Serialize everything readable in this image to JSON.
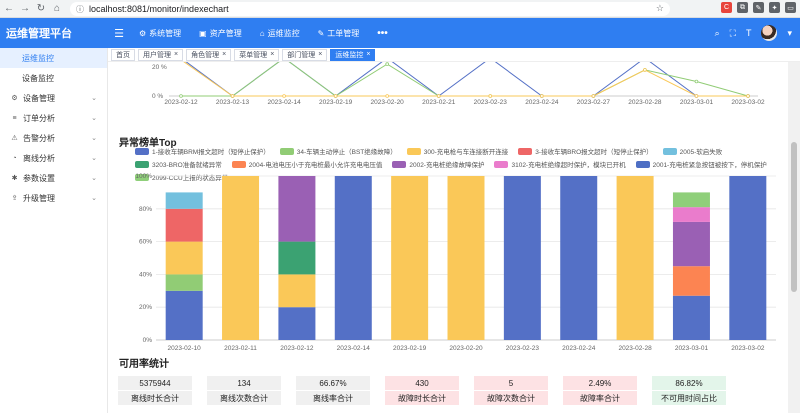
{
  "browser": {
    "url": "localhost:8081/monitor/indexechart",
    "ext_icons": [
      {
        "name": "c-extension-icon",
        "color": "#e8453c",
        "label": "C"
      },
      {
        "name": "copy-icon",
        "color": "#5f6368",
        "label": "⧉"
      },
      {
        "name": "edit-icon",
        "color": "#5f6368",
        "label": "✎"
      },
      {
        "name": "puzzle-icon",
        "color": "#5f6368",
        "label": "✦"
      },
      {
        "name": "window-icon",
        "color": "#5f6368",
        "label": "▭"
      }
    ]
  },
  "header": {
    "brand": "运维管理平台",
    "nav": [
      {
        "label": "系统管理",
        "icon": "⚙"
      },
      {
        "label": "资产管理",
        "icon": "▣"
      },
      {
        "label": "运维监控",
        "icon": "⌂"
      },
      {
        "label": "工单管理",
        "icon": "✎"
      }
    ],
    "more": "•••"
  },
  "sidebar": {
    "items": [
      {
        "label": "运维监控",
        "type": "sub",
        "active": true
      },
      {
        "label": "设备监控",
        "type": "sub",
        "active": false
      },
      {
        "label": "设备管理",
        "type": "group",
        "icon": "⚙"
      },
      {
        "label": "订单分析",
        "type": "group",
        "icon": "≡"
      },
      {
        "label": "告警分析",
        "type": "group",
        "icon": "⚠"
      },
      {
        "label": "离线分析",
        "type": "group",
        "icon": "◔"
      },
      {
        "label": "参数设置",
        "type": "group",
        "icon": "✱"
      },
      {
        "label": "升级管理",
        "type": "group",
        "icon": "⇪"
      }
    ]
  },
  "tabs": [
    {
      "label": "首页",
      "closable": false,
      "active": false
    },
    {
      "label": "用户管理",
      "closable": true,
      "active": false
    },
    {
      "label": "角色管理",
      "closable": true,
      "active": false
    },
    {
      "label": "菜单管理",
      "closable": true,
      "active": false
    },
    {
      "label": "部门管理",
      "closable": true,
      "active": false
    },
    {
      "label": "运维监控",
      "closable": true,
      "active": true
    }
  ],
  "sections": {
    "anomaly_title": "异常榜单Top",
    "availability_title": "可用率统计"
  },
  "chart_data": [
    {
      "type": "line",
      "partially_visible": true,
      "categories": [
        "2023-02-12",
        "2023-02-13",
        "2023-02-14",
        "2023-02-19",
        "2023-02-20",
        "2023-02-21",
        "2023-02-23",
        "2023-02-24",
        "2023-02-27",
        "2023-02-28",
        "2023-03-01",
        "2023-03-02"
      ],
      "y_ticks": [
        "20 %",
        "0 %"
      ],
      "series": [
        {
          "color": "#5470c6",
          "values": [
            30,
            0,
            30,
            0,
            30,
            0,
            30,
            0,
            0,
            30,
            0,
            0
          ]
        },
        {
          "color": "#91cc75",
          "values": [
            0,
            0,
            30,
            0,
            22,
            0,
            0,
            0,
            0,
            18,
            10,
            0
          ]
        },
        {
          "color": "#fac858",
          "values": [
            25,
            0,
            0,
            0,
            0,
            0,
            0,
            0,
            0,
            18,
            0,
            0
          ]
        }
      ]
    },
    {
      "type": "bar",
      "stacked": true,
      "title": "异常榜单Top",
      "categories": [
        "2023-02-10",
        "2023-02-11",
        "2023-02-12",
        "2023-02-14",
        "2023-02-19",
        "2023-02-20",
        "2023-02-23",
        "2023-02-24",
        "2023-02-28",
        "2023-03-01",
        "2023-03-02"
      ],
      "y_ticks": [
        "0%",
        "20%",
        "40%",
        "60%",
        "80%",
        "100%"
      ],
      "ylim": [
        0,
        100
      ],
      "legend_position": "top",
      "series": [
        {
          "name": "1-接收车辆BRM报文超时（短停止保护）",
          "color": "#5470c6",
          "values": [
            30,
            0,
            20,
            100,
            0,
            0,
            100,
            100,
            0,
            27,
            100
          ]
        },
        {
          "name": "34-车辆主动停止（BST绝缘故障）",
          "color": "#91cc75",
          "values": [
            10,
            0,
            0,
            0,
            0,
            0,
            0,
            0,
            0,
            0,
            0
          ]
        },
        {
          "name": "300-充电枪与车连接断开连接",
          "color": "#fac858",
          "values": [
            20,
            100,
            20,
            0,
            100,
            100,
            0,
            0,
            100,
            0,
            0
          ]
        },
        {
          "name": "3-接收车辆BRO报文超时（短停止保护）",
          "color": "#ee6666",
          "values": [
            20,
            0,
            0,
            0,
            0,
            0,
            0,
            0,
            0,
            0,
            0
          ]
        },
        {
          "name": "2005-软启失败",
          "color": "#73c0de",
          "values": [
            10,
            0,
            0,
            0,
            0,
            0,
            0,
            0,
            0,
            0,
            0
          ]
        },
        {
          "name": "3203-BRO准备就绪异常",
          "color": "#3ba272",
          "values": [
            0,
            0,
            20,
            0,
            0,
            0,
            0,
            0,
            0,
            0,
            0
          ]
        },
        {
          "name": "2004-电池电压小于充电桩最小允许充电电压值",
          "color": "#fc8452",
          "values": [
            0,
            0,
            0,
            0,
            0,
            0,
            0,
            0,
            0,
            18,
            0
          ]
        },
        {
          "name": "2002-充电桩绝缘故障保护",
          "color": "#9a60b4",
          "values": [
            0,
            0,
            40,
            0,
            0,
            0,
            0,
            0,
            0,
            27,
            0
          ]
        },
        {
          "name": "3102-充电桩绝缘超时保护，模块已开机",
          "color": "#ea7ccc",
          "values": [
            0,
            0,
            0,
            0,
            0,
            0,
            0,
            0,
            0,
            9,
            0
          ]
        },
        {
          "name": "2001-充电桩紧急按钮被按下，停机保护",
          "color": "#4e6fc4",
          "values": [
            0,
            0,
            0,
            0,
            0,
            0,
            0,
            0,
            0,
            0,
            0
          ]
        },
        {
          "name": "2099-CCU上报的状态异常",
          "color": "#8fcf7a",
          "values": [
            0,
            0,
            0,
            0,
            0,
            0,
            0,
            0,
            0,
            9,
            0
          ]
        }
      ]
    }
  ],
  "stats": [
    {
      "value": "5375944",
      "label": "离线时长合计",
      "tone": "grey"
    },
    {
      "value": "134",
      "label": "离线次数合计",
      "tone": "grey"
    },
    {
      "value": "66.67%",
      "label": "离线率合计",
      "tone": "grey"
    },
    {
      "value": "430",
      "label": "故障时长合计",
      "tone": "pink"
    },
    {
      "value": "5",
      "label": "故障次数合计",
      "tone": "pink"
    },
    {
      "value": "2.49%",
      "label": "故障率合计",
      "tone": "pink"
    },
    {
      "value": "86.82%",
      "label": "不可用时间占比",
      "tone": "green"
    }
  ]
}
